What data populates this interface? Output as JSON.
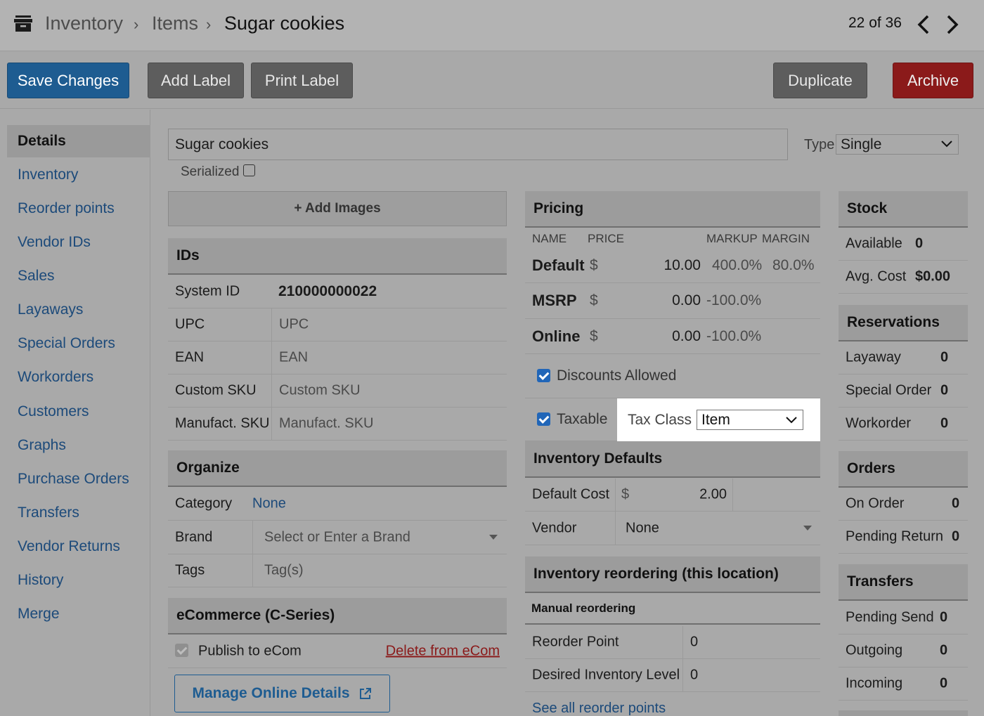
{
  "header": {
    "breadcrumb": [
      "Inventory",
      "Items",
      "Sugar cookies"
    ],
    "pager": "22 of 36"
  },
  "toolbar": {
    "save": "Save Changes",
    "add_label": "Add Label",
    "print_label": "Print Label",
    "duplicate": "Duplicate",
    "archive": "Archive"
  },
  "sidebar": {
    "items": [
      "Details",
      "Inventory",
      "Reorder points",
      "Vendor IDs",
      "Sales",
      "Layaways",
      "Special Orders",
      "Workorders",
      "Customers",
      "Graphs",
      "Purchase Orders",
      "Transfers",
      "Vendor Returns",
      "History",
      "Merge"
    ]
  },
  "item": {
    "name": "Sugar cookies",
    "type_label": "Type",
    "type_value": "Single",
    "serialized_label": "Serialized",
    "add_images": "+ Add Images"
  },
  "ids": {
    "title": "IDs",
    "system_id_label": "System ID",
    "system_id": "210000000022",
    "upc_label": "UPC",
    "upc_placeholder": "UPC",
    "ean_label": "EAN",
    "ean_placeholder": "EAN",
    "custom_sku_label": "Custom SKU",
    "custom_sku_placeholder": "Custom SKU",
    "manufact_sku_label": "Manufact. SKU",
    "manufact_sku_placeholder": "Manufact. SKU"
  },
  "organize": {
    "title": "Organize",
    "category_label": "Category",
    "category_value": "None",
    "brand_label": "Brand",
    "brand_placeholder": "Select or Enter a Brand",
    "tags_label": "Tags",
    "tags_placeholder": "Tag(s)"
  },
  "ecommerce": {
    "title": "eCommerce (C-Series)",
    "publish_label": "Publish to eCom",
    "delete_link": "Delete from eCom",
    "manage_button": "Manage Online Details"
  },
  "pricing": {
    "title": "Pricing",
    "columns": {
      "name": "NAME",
      "price": "PRICE",
      "markup": "MARKUP",
      "margin": "MARGIN"
    },
    "currency": "$",
    "rows": [
      {
        "name": "Default",
        "price": "10.00",
        "markup": "400.0%",
        "margin": "80.0%"
      },
      {
        "name": "MSRP",
        "price": "0.00",
        "markup": "-100.0%"
      },
      {
        "name": "Online",
        "price": "0.00",
        "markup": "-100.0%"
      }
    ],
    "discounts_label": "Discounts Allowed",
    "taxable_label": "Taxable",
    "tax_class_label": "Tax Class",
    "tax_class_value": "Item"
  },
  "inventory_defaults": {
    "title": "Inventory Defaults",
    "default_cost_label": "Default Cost",
    "currency": "$",
    "default_cost": "2.00",
    "vendor_label": "Vendor",
    "vendor_value": "None"
  },
  "reordering": {
    "title": "Inventory reordering (this location)",
    "subtitle": "Manual reordering",
    "reorder_point_label": "Reorder Point",
    "reorder_point": "0",
    "desired_level_label": "Desired Inventory Level",
    "desired_level": "0",
    "see_all_link": "See all reorder points"
  },
  "stock": {
    "title": "Stock",
    "available_label": "Available",
    "available": "0",
    "avg_cost_label": "Avg. Cost",
    "avg_cost": "$0.00"
  },
  "reservations": {
    "title": "Reservations",
    "layaway_label": "Layaway",
    "layaway": "0",
    "special_order_label": "Special Order",
    "special_order": "0",
    "workorder_label": "Workorder",
    "workorder": "0"
  },
  "orders": {
    "title": "Orders",
    "on_order_label": "On Order",
    "on_order": "0",
    "pending_return_label": "Pending Return",
    "pending_return": "0"
  },
  "transfers": {
    "title": "Transfers",
    "pending_send_label": "Pending Send",
    "pending_send": "0",
    "outgoing_label": "Outgoing",
    "outgoing": "0",
    "incoming_label": "Incoming",
    "incoming": "0"
  },
  "colors": {
    "primary": "#1e5c91",
    "danger": "#8b1a1a",
    "neutral_button": "#5d5d5d",
    "link": "#1c4a7a",
    "checkbox": "#2166b8",
    "highlight": "#ffffff"
  }
}
